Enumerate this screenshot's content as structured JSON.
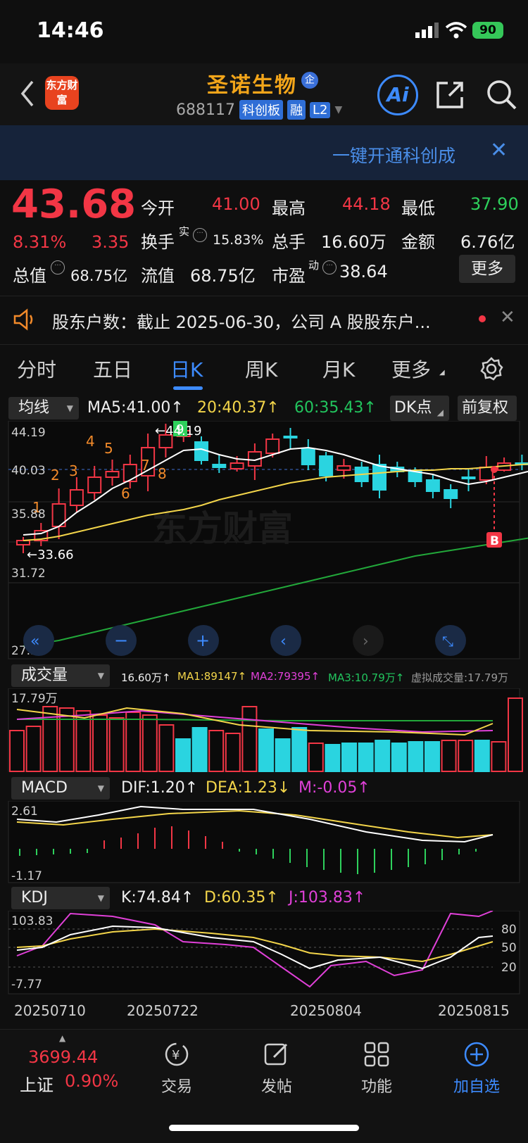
{
  "status": {
    "time": "14:46",
    "battery": "90"
  },
  "header": {
    "logo": "东方财富",
    "stock_name": "圣诺生物",
    "qi_badge": "企",
    "code": "688117",
    "tags": [
      "科创板",
      "融",
      "L2"
    ],
    "ai_label": "Ai"
  },
  "banner": {
    "text": "一键开通科创成"
  },
  "quote": {
    "price": "43.68",
    "change_pct": "8.31%",
    "change_amt": "3.35",
    "open_label": "今开",
    "open": "41.00",
    "high_label": "最高",
    "high": "44.18",
    "low_label": "最低",
    "low": "37.90",
    "turnover_label": "换手",
    "turnover_sup": "实",
    "turnover": "15.83%",
    "volume_label": "总手",
    "volume": "16.60万",
    "amount_label": "金额",
    "amount": "6.76亿",
    "mktcap_label": "总值",
    "mktcap": "68.75亿",
    "float_label": "流值",
    "float": "68.75亿",
    "pe_label": "市盈",
    "pe_sup": "动",
    "pe": "38.64",
    "more": "更多"
  },
  "news": {
    "text": "股东户数：截止 2025-06-30，公司 A 股股东户..."
  },
  "tabs": [
    "分时",
    "五日",
    "日K",
    "周K",
    "月K",
    "更多"
  ],
  "kline": {
    "dropdown": "均线",
    "ma5": "MA5:41.00↑",
    "ma20": "20:40.37↑",
    "ma60": "60:35.43↑",
    "dk_point": "DK点",
    "adjust": "前复权",
    "y_labels": [
      "44.19",
      "40.03",
      "35.88",
      "31.72",
      "27.56"
    ],
    "high_mark": "←44.19",
    "low_mark": "←33.66",
    "b_mark": "B",
    "colors": {
      "up": "#f23645",
      "down": "#2ad4e0",
      "ma5": "#ffffff",
      "ma20": "#f3d54a",
      "ma60": "#22a83a"
    }
  },
  "volume": {
    "dropdown": "成交量",
    "vol": "16.60万↑",
    "ma1": "MA1:89147↑",
    "ma2": "MA2:79395↑",
    "ma3": "MA3:10.79万↑",
    "virtual": "虚拟成交量:17.79万",
    "y_label": "17.79万"
  },
  "macd": {
    "dropdown": "MACD",
    "dif": "DIF:1.20↑",
    "dea": "DEA:1.23↓",
    "m": "M:-0.05↑",
    "y_top": "2.61",
    "y_bottom": "-1.17"
  },
  "kdj": {
    "dropdown": "KDJ",
    "k": "K:74.84↑",
    "d": "D:60.35↑",
    "j": "J:103.83↑",
    "y_top": "103.83",
    "y_bottom": "-7.77",
    "levels": [
      "80",
      "50",
      "20"
    ]
  },
  "dates": [
    "20250710",
    "20250722",
    "20250804",
    "20250815"
  ],
  "bottom": {
    "index_value": "3699.44",
    "index_name": "上证",
    "index_change": "0.90%",
    "trade": "交易",
    "post": "发帖",
    "functions": "功能",
    "add_watch": "加自选"
  }
}
